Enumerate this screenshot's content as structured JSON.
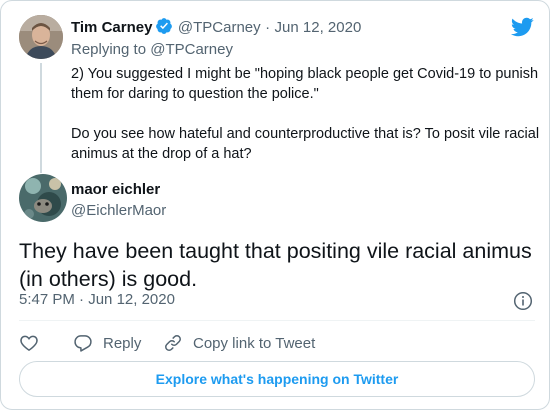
{
  "parent_tweet": {
    "author_name": "Tim Carney",
    "author_handle": "@TPCarney",
    "separator": "·",
    "date": "Jun 12, 2020",
    "replying_to_prefix": "Replying to ",
    "replying_to_handle": "@TPCarney",
    "paragraphs": [
      "2) You suggested I might be \"hoping black people get Covid-19 to punish them for daring to question the police.\"",
      "Do you see how hateful and counterproductive that is? To posit vile racial animus at the drop of a hat?"
    ]
  },
  "main_tweet": {
    "author_name": "maor eichler",
    "author_handle": "@EichlerMaor",
    "text": "They have been taught that positing vile racial animus (in others) is good.",
    "time": "5:47 PM",
    "separator": "·",
    "date": "Jun 12, 2020"
  },
  "actions": {
    "reply_label": "Reply",
    "copy_link_label": "Copy link to Tweet"
  },
  "explore_label": "Explore what's happening on Twitter",
  "colors": {
    "brand_blue": "#1d9bf0",
    "text_primary": "#0f1419",
    "text_secondary": "#536471",
    "border": "#cfd9de"
  },
  "icons": {
    "brand": "twitter-bird-icon",
    "verified": "verified-badge-icon",
    "info": "info-icon",
    "like": "heart-icon",
    "reply": "reply-bubble-icon",
    "copy_link": "link-icon"
  }
}
